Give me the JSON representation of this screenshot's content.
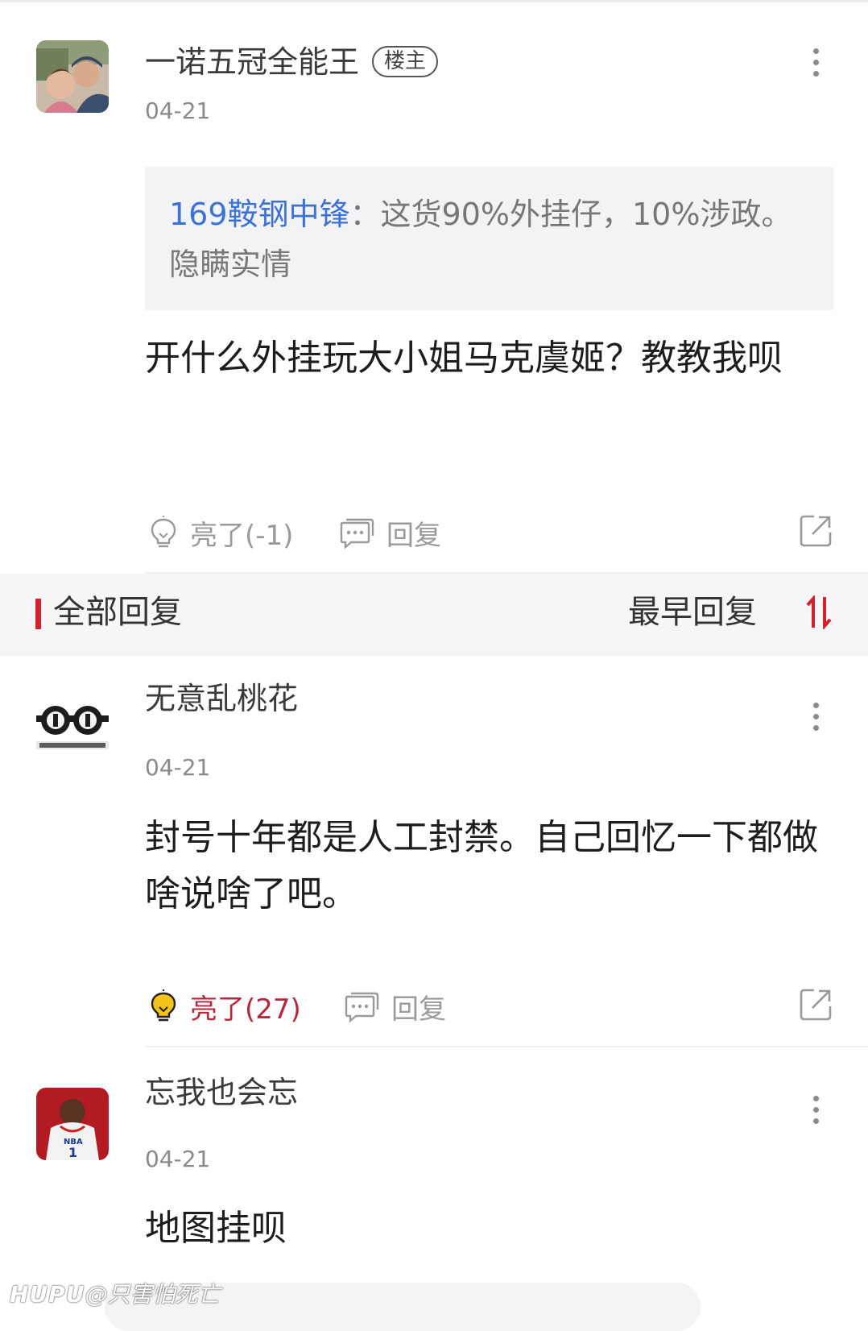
{
  "op_post": {
    "username": "一诺五冠全能王",
    "badge": "楼主",
    "date": "04-21",
    "quote_name": "169鞍钢中锋",
    "quote_sep": "：",
    "quote_text": "这货90%外挂仔，10%涉政。隐瞒实情",
    "content": "开什么外挂玩大小姐马克虞姬？教教我呗",
    "like_label": "亮了(-1)",
    "reply_label": "回复"
  },
  "section": {
    "title": "全部回复",
    "sort_label": "最早回复",
    "accent": "#d3222f"
  },
  "replies": [
    {
      "username": "无意乱桃花",
      "date": "04-21",
      "content": "封号十年都是人工封禁。自己回忆一下都做啥说啥了吧。",
      "like_label": "亮了(27)",
      "reply_label": "回复",
      "liked": true
    },
    {
      "username": "忘我也会忘",
      "date": "04-21",
      "content": "地图挂呗"
    }
  ],
  "watermark": {
    "brand": "HUPU",
    "user": "@只害怕死亡"
  },
  "icons": [
    "more-icon",
    "lightbulb-icon",
    "comment-icon",
    "share-icon",
    "sort-icon"
  ],
  "colors": {
    "link_blue": "#3b73d6",
    "like_red": "#b5273b",
    "lit_yellow": "#f3c318"
  }
}
